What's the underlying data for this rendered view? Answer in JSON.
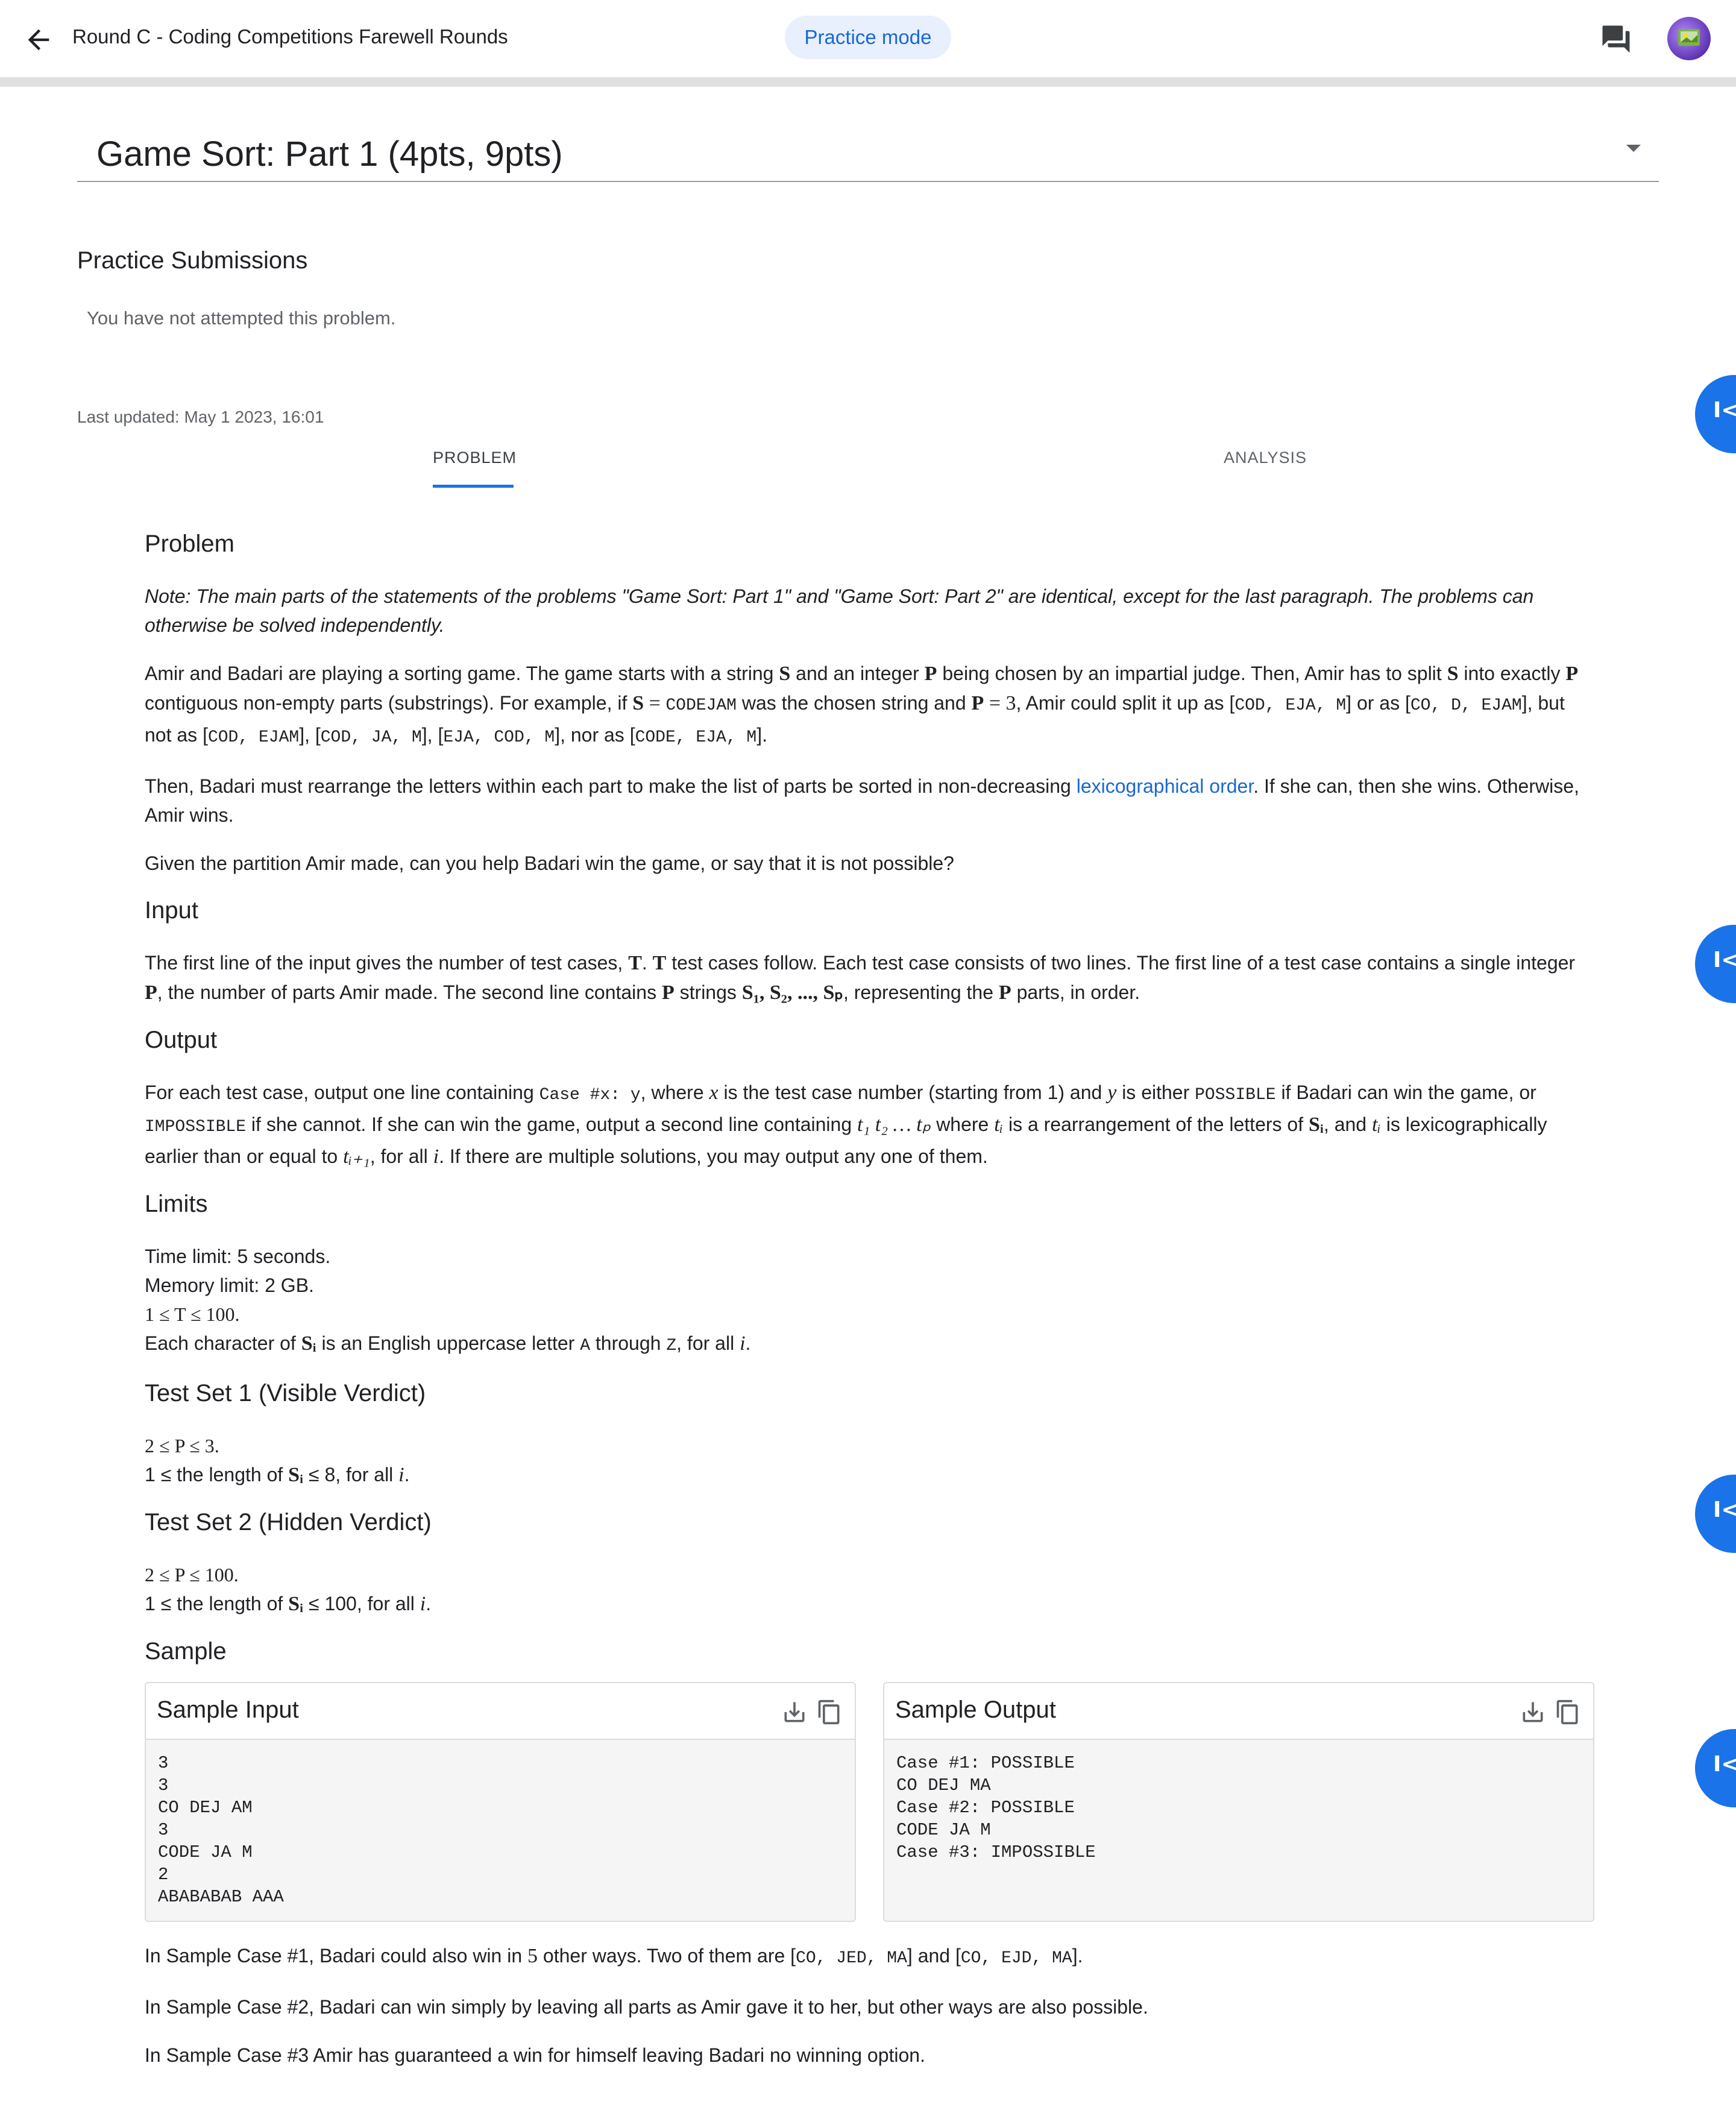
{
  "header": {
    "title": "Round C - Coding Competitions Farewell Rounds",
    "mode_chip": "Practice mode",
    "back_icon": "arrow-back-icon",
    "chat_icon": "forum-icon"
  },
  "problem_selector": {
    "value": "Game Sort: Part 1 (4pts, 9pts)"
  },
  "submissions": {
    "title": "Practice Submissions",
    "status": "You have not attempted this problem."
  },
  "last_updated": "Last updated: May 1 2023, 16:01",
  "tabs": [
    {
      "label": "PROBLEM",
      "active": true
    },
    {
      "label": "ANALYSIS",
      "active": false
    }
  ],
  "statement": {
    "problem_h": "Problem",
    "note": "Note: The main parts of the statements of the problems \"Game Sort: Part 1\" and \"Game Sort: Part 2\" are identical, except for the last paragraph. The problems can otherwise be solved independently.",
    "p1": {
      "a": "Amir and Badari are playing a sorting game. The game starts with a string ",
      "S": "S",
      "b": " and an integer ",
      "P": "P",
      "c": " being chosen by an impartial judge. Then, Amir has to split ",
      "d": " into exactly ",
      "e": " contiguous non-empty parts (substrings). For example, if ",
      "eq": " = ",
      "codejam": "CODEJAM",
      "f": " was the chosen string and ",
      "eq3": " = 3",
      "g": ", Amir could split it up as [",
      "s1": "COD, EJA, M",
      "h": "] or as [",
      "s2": "CO, D, EJAM",
      "i": "], but not as [",
      "s3": "COD, EJAM",
      "j": "], [",
      "s4": "COD, JA, M",
      "k": "], [",
      "s5": "EJA, COD, M",
      "l": "], nor as [",
      "s6": "CODE, EJA, M",
      "m": "]."
    },
    "p2": {
      "a": "Then, Badari must rearrange the letters within each part to make the list of parts be sorted in non-decreasing ",
      "link": "lexicographical order",
      "b": ". If she can, then she wins. Otherwise, Amir wins."
    },
    "p3": "Given the partition Amir made, can you help Badari win the game, or say that it is not possible?",
    "input_h": "Input",
    "input": {
      "a": "The first line of the input gives the number of test cases, ",
      "T": "T",
      "b": ". ",
      "c": " test cases follow. Each test case consists of two lines. The first line of a test case contains a single integer ",
      "P": "P",
      "d": ", the number of parts Amir made. The second line contains ",
      "e": " strings ",
      "seq": "S₁, S₂, ..., Sₚ",
      "f": ", representing the ",
      "g": " parts, in order."
    },
    "output_h": "Output",
    "output": {
      "a": "For each test case, output one line containing ",
      "case": "Case #x: y",
      "b": ", where ",
      "x": "x",
      "c": " is the test case number (starting from 1) and ",
      "y": "y",
      "d": " is either ",
      "possible": "POSSIBLE",
      "e": " if Badari can win the game, or ",
      "impossible": "IMPOSSIBLE",
      "f": " if she cannot. If she can win the game, output a second line containing ",
      "ts": "t₁ t₂ … tₚ",
      "g": " where ",
      "ti": "tᵢ",
      "h": " is a rearrangement of the letters of ",
      "si": "Sᵢ",
      "i": ", and ",
      "j": " is lexicographically earlier than or equal to ",
      "ti1": "tᵢ₊₁",
      "k": ", for all ",
      "iv": "i",
      "l": ". If there are multiple solutions, you may output any one of them."
    },
    "limits_h": "Limits",
    "limits": {
      "time": "Time limit: 5 seconds.",
      "memory": "Memory limit: 2 GB.",
      "t_range": "1 ≤ T ≤ 100.",
      "char_a": "Each character of ",
      "char_si": "Sᵢ",
      "char_b": " is an English uppercase letter ",
      "char_A": "A",
      "char_c": " through ",
      "char_Z": "Z",
      "char_d": ", for all ",
      "char_i": "i",
      "char_e": "."
    },
    "ts1_h": "Test Set 1 (Visible Verdict)",
    "ts1": {
      "p_range": "2 ≤ P ≤ 3.",
      "len_a": "1 ≤ the length of ",
      "len_si": "Sᵢ",
      "len_b": " ≤ 8, for all ",
      "len_i": "i",
      "len_c": "."
    },
    "ts2_h": "Test Set 2 (Hidden Verdict)",
    "ts2": {
      "p_range": "2 ≤ P ≤ 100.",
      "len_a": "1 ≤ the length of ",
      "len_si": "Sᵢ",
      "len_b": " ≤ 100, for all ",
      "len_i": "i",
      "len_c": "."
    },
    "sample_h": "Sample"
  },
  "sample_input": {
    "title": "Sample Input",
    "body": "3\n3\nCO DEJ AM\n3\nCODE JA M\n2\nABABABAB AAA"
  },
  "sample_output": {
    "title": "Sample Output",
    "body": "Case #1: POSSIBLE\nCO DEJ MA\nCase #2: POSSIBLE\nCODE JA M\nCase #3: IMPOSSIBLE"
  },
  "explanations": {
    "e1": {
      "a": "In Sample Case #1, Badari could also win in ",
      "n": "5",
      "b": " other ways. Two of them are [",
      "x1": "CO, JED, MA",
      "c": "] and [",
      "x2": "CO, EJD, MA",
      "d": "]."
    },
    "e2": "In Sample Case #2, Badari can win simply by leaving all parts as Amir gave it to her, but other ways are also possible.",
    "e3": "In Sample Case #3 Amir has guaranteed a win for himself leaving Badari no winning option."
  },
  "side_fab_glyph": "I<",
  "colors": {
    "accent": "#1a73e8",
    "chip_bg": "#e8f0fe",
    "chip_text": "#1967d2",
    "link": "#1967d2"
  }
}
